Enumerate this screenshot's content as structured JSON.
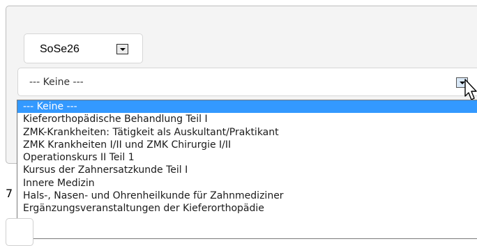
{
  "semester_select": {
    "value": "SoSe26",
    "arrow_icon": "chevron-down-icon"
  },
  "course_select": {
    "value": "--- Keine ---",
    "arrow_icon": "chevron-down-icon",
    "options": [
      "--- Keine ---",
      "Kieferorthopädische Behandlung Teil I",
      "ZMK-Krankheiten: Tätigkeit als Auskultant/Praktikant",
      "ZMK Krankheiten I/II und ZMK Chirurgie I/II",
      "Operationskurs II Teil 1",
      "Kursus der Zahnersatzkunde Teil I",
      "Innere Medizin",
      "Hals-, Nasen- und Ohrenheilkunde für Zahnmediziner",
      "Ergänzungsveranstaltungen der Kieferorthopädie"
    ],
    "selected_index": 0
  },
  "partial_text": "7",
  "colors": {
    "selection": "#3399ff",
    "panel_background": "#f4f4f4"
  },
  "cursor_icon": "mouse-pointer-icon"
}
